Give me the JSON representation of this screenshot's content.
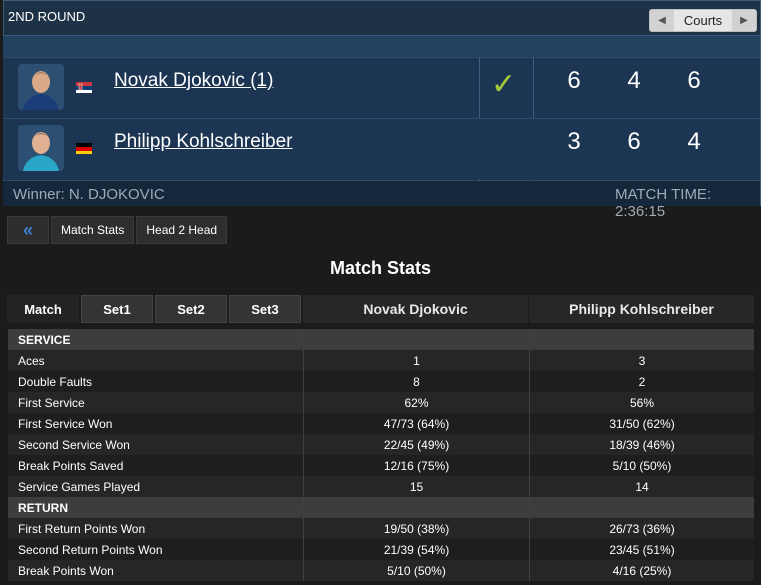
{
  "header": {
    "round": "2ND ROUND",
    "courts_label": "Courts",
    "winner_text": "Winner: N. DJOKOVIC",
    "match_time": "MATCH TIME: 2:36:15",
    "winner_mark": "✓"
  },
  "players": [
    {
      "name": "Novak Djokovic (1)",
      "flag": "serbia-flag",
      "scores": [
        "6",
        "4",
        "6"
      ]
    },
    {
      "name": "Philipp Kohlschreiber",
      "flag": "germany-flag",
      "scores": [
        "3",
        "6",
        "4"
      ]
    }
  ],
  "tabs": {
    "back": "«",
    "stats": "Match Stats",
    "h2h": "Head 2 Head"
  },
  "stats": {
    "title": "Match Stats",
    "set_tabs": [
      "Match",
      "Set1",
      "Set2",
      "Set3"
    ],
    "col1": "Novak Djokovic",
    "col2": "Philipp Kohlschreiber",
    "rows": [
      {
        "section": true,
        "label": "SERVICE",
        "a": "",
        "b": ""
      },
      {
        "label": "Aces",
        "a": "1",
        "b": "3"
      },
      {
        "label": "Double Faults",
        "a": "8",
        "b": "2"
      },
      {
        "label": "First Service",
        "a": "62%",
        "b": "56%"
      },
      {
        "label": "First Service Won",
        "a": "47/73 (64%)",
        "b": "31/50 (62%)"
      },
      {
        "label": "Second Service Won",
        "a": "22/45 (49%)",
        "b": "18/39 (46%)"
      },
      {
        "label": "Break Points Saved",
        "a": "12/16 (75%)",
        "b": "5/10 (50%)"
      },
      {
        "label": "Service Games Played",
        "a": "15",
        "b": "14"
      },
      {
        "section": true,
        "label": "RETURN",
        "a": "",
        "b": ""
      },
      {
        "label": "First Return Points Won",
        "a": "19/50 (38%)",
        "b": "26/73 (36%)"
      },
      {
        "label": "Second Return Points Won",
        "a": "21/39 (54%)",
        "b": "23/45 (51%)"
      },
      {
        "label": "Break Points Won",
        "a": "5/10 (50%)",
        "b": "4/16 (25%)"
      }
    ]
  }
}
